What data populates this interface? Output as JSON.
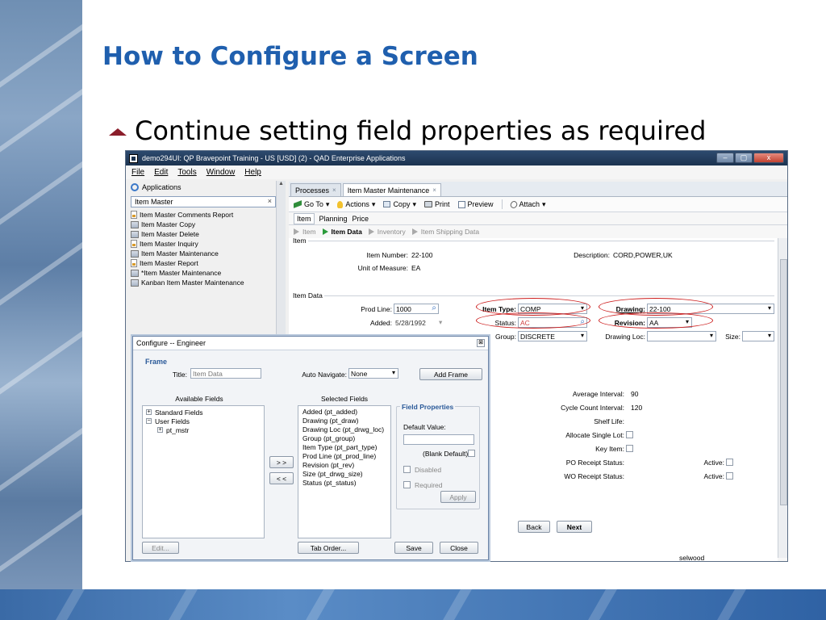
{
  "slide": {
    "title": "How to Configure a Screen",
    "bullet": "Continue setting field properties as required"
  },
  "window": {
    "title": "demo294UI: QP Bravepoint Training - US [USD] (2) - QAD Enterprise Applications",
    "controls": [
      "‒",
      "▢",
      "x"
    ]
  },
  "menu": [
    "File",
    "Edit",
    "Tools",
    "Window",
    "Help"
  ],
  "nav": {
    "header": "Applications",
    "search_value": "Item Master",
    "clear": "×",
    "items": [
      {
        "label": "Item Master Comments Report",
        "icon": "report-icon"
      },
      {
        "label": "Item Master Copy",
        "icon": "form-icon"
      },
      {
        "label": "Item Master Delete",
        "icon": "form-icon"
      },
      {
        "label": "Item Master Inquiry",
        "icon": "report-icon"
      },
      {
        "label": "Item Master Maintenance",
        "icon": "form-icon"
      },
      {
        "label": "Item Master Report",
        "icon": "report-icon"
      },
      {
        "label": "*Item Master Maintenance",
        "icon": "form-icon"
      },
      {
        "label": "Kanban Item Master Maintenance",
        "icon": "form-icon"
      }
    ]
  },
  "tabs": [
    {
      "label": "Processes",
      "close": "×"
    },
    {
      "label": "Item Master Maintenance",
      "close": "×"
    }
  ],
  "toolbar": {
    "goto": "Go To",
    "actions": "Actions",
    "copy": "Copy",
    "print": "Print",
    "preview": "Preview",
    "attach": "Attach",
    "caret": "▾"
  },
  "subtabs": [
    "Item",
    "Planning",
    "Price"
  ],
  "crumbs": [
    "Item",
    "Item Data",
    "Inventory",
    "Item Shipping Data"
  ],
  "item_section": {
    "label": "Item",
    "item_number_label": "Item Number:",
    "item_number": "22-100",
    "uom_label": "Unit of Measure:",
    "uom": "EA",
    "description_label": "Description:",
    "description": "CORD,POWER,UK"
  },
  "item_data_section": {
    "label": "Item Data",
    "prod_line_label": "Prod Line:",
    "prod_line": "1000",
    "added_label": "Added:",
    "added": "5/28/1992",
    "item_type_label": "Item Type:",
    "item_type": "COMP",
    "status_label": "Status:",
    "status": "AC",
    "group_label": "Group:",
    "group": "DISCRETE",
    "drawing_label": "Drawing:",
    "drawing": "22-100",
    "revision_label": "Revision:",
    "revision": "AA",
    "drawing_loc_label": "Drawing Loc:",
    "drawing_loc": "",
    "size_label": "Size:",
    "size": ""
  },
  "inventory_fields": {
    "average_interval_label": "Average Interval:",
    "average_interval": "90",
    "cycle_count_label": "Cycle Count Interval:",
    "cycle_count": "120",
    "shelf_life_label": "Shelf Life:",
    "allocate_single_lot_label": "Allocate Single Lot:",
    "key_item_label": "Key Item:",
    "po_receipt_label": "PO Receipt Status:",
    "wo_receipt_label": "WO Receipt Status:",
    "active_label": "Active:"
  },
  "nav_buttons": {
    "back": "Back",
    "next": "Next"
  },
  "status_user": "selwood",
  "dialog": {
    "title": "Configure -- Engineer",
    "close": "⊠",
    "frame_label": "Frame",
    "title_label": "Title:",
    "title_placeholder": "Item Data",
    "auto_navigate_label": "Auto Navigate:",
    "auto_navigate": "None",
    "add_frame": "Add Frame",
    "available_label": "Available Fields",
    "available_tree": [
      {
        "label": "Standard Fields",
        "expander": "+",
        "indent": 0
      },
      {
        "label": "User Fields",
        "expander": "−",
        "indent": 0
      },
      {
        "label": "pt_mstr",
        "expander": "+",
        "indent": 1
      }
    ],
    "selected_label": "Selected Fields",
    "selected": [
      "Added (pt_added)",
      "Drawing (pt_draw)",
      "Drawing Loc (pt_drwg_loc)",
      "Group (pt_group)",
      "Item Type (pt_part_type)",
      "Prod Line (pt_prod_line)",
      "Revision (pt_rev)",
      "Size (pt_drwg_size)",
      "Status (pt_status)"
    ],
    "move_right": "> >",
    "move_left": "< <",
    "field_props_label": "Field Properties",
    "default_value_label": "Default Value:",
    "blank_default_label": "(Blank Default)",
    "disabled_label": "Disabled",
    "required_label": "Required",
    "apply": "Apply",
    "edit": "Edit...",
    "tab_order": "Tab Order...",
    "save": "Save",
    "close_btn": "Close"
  }
}
